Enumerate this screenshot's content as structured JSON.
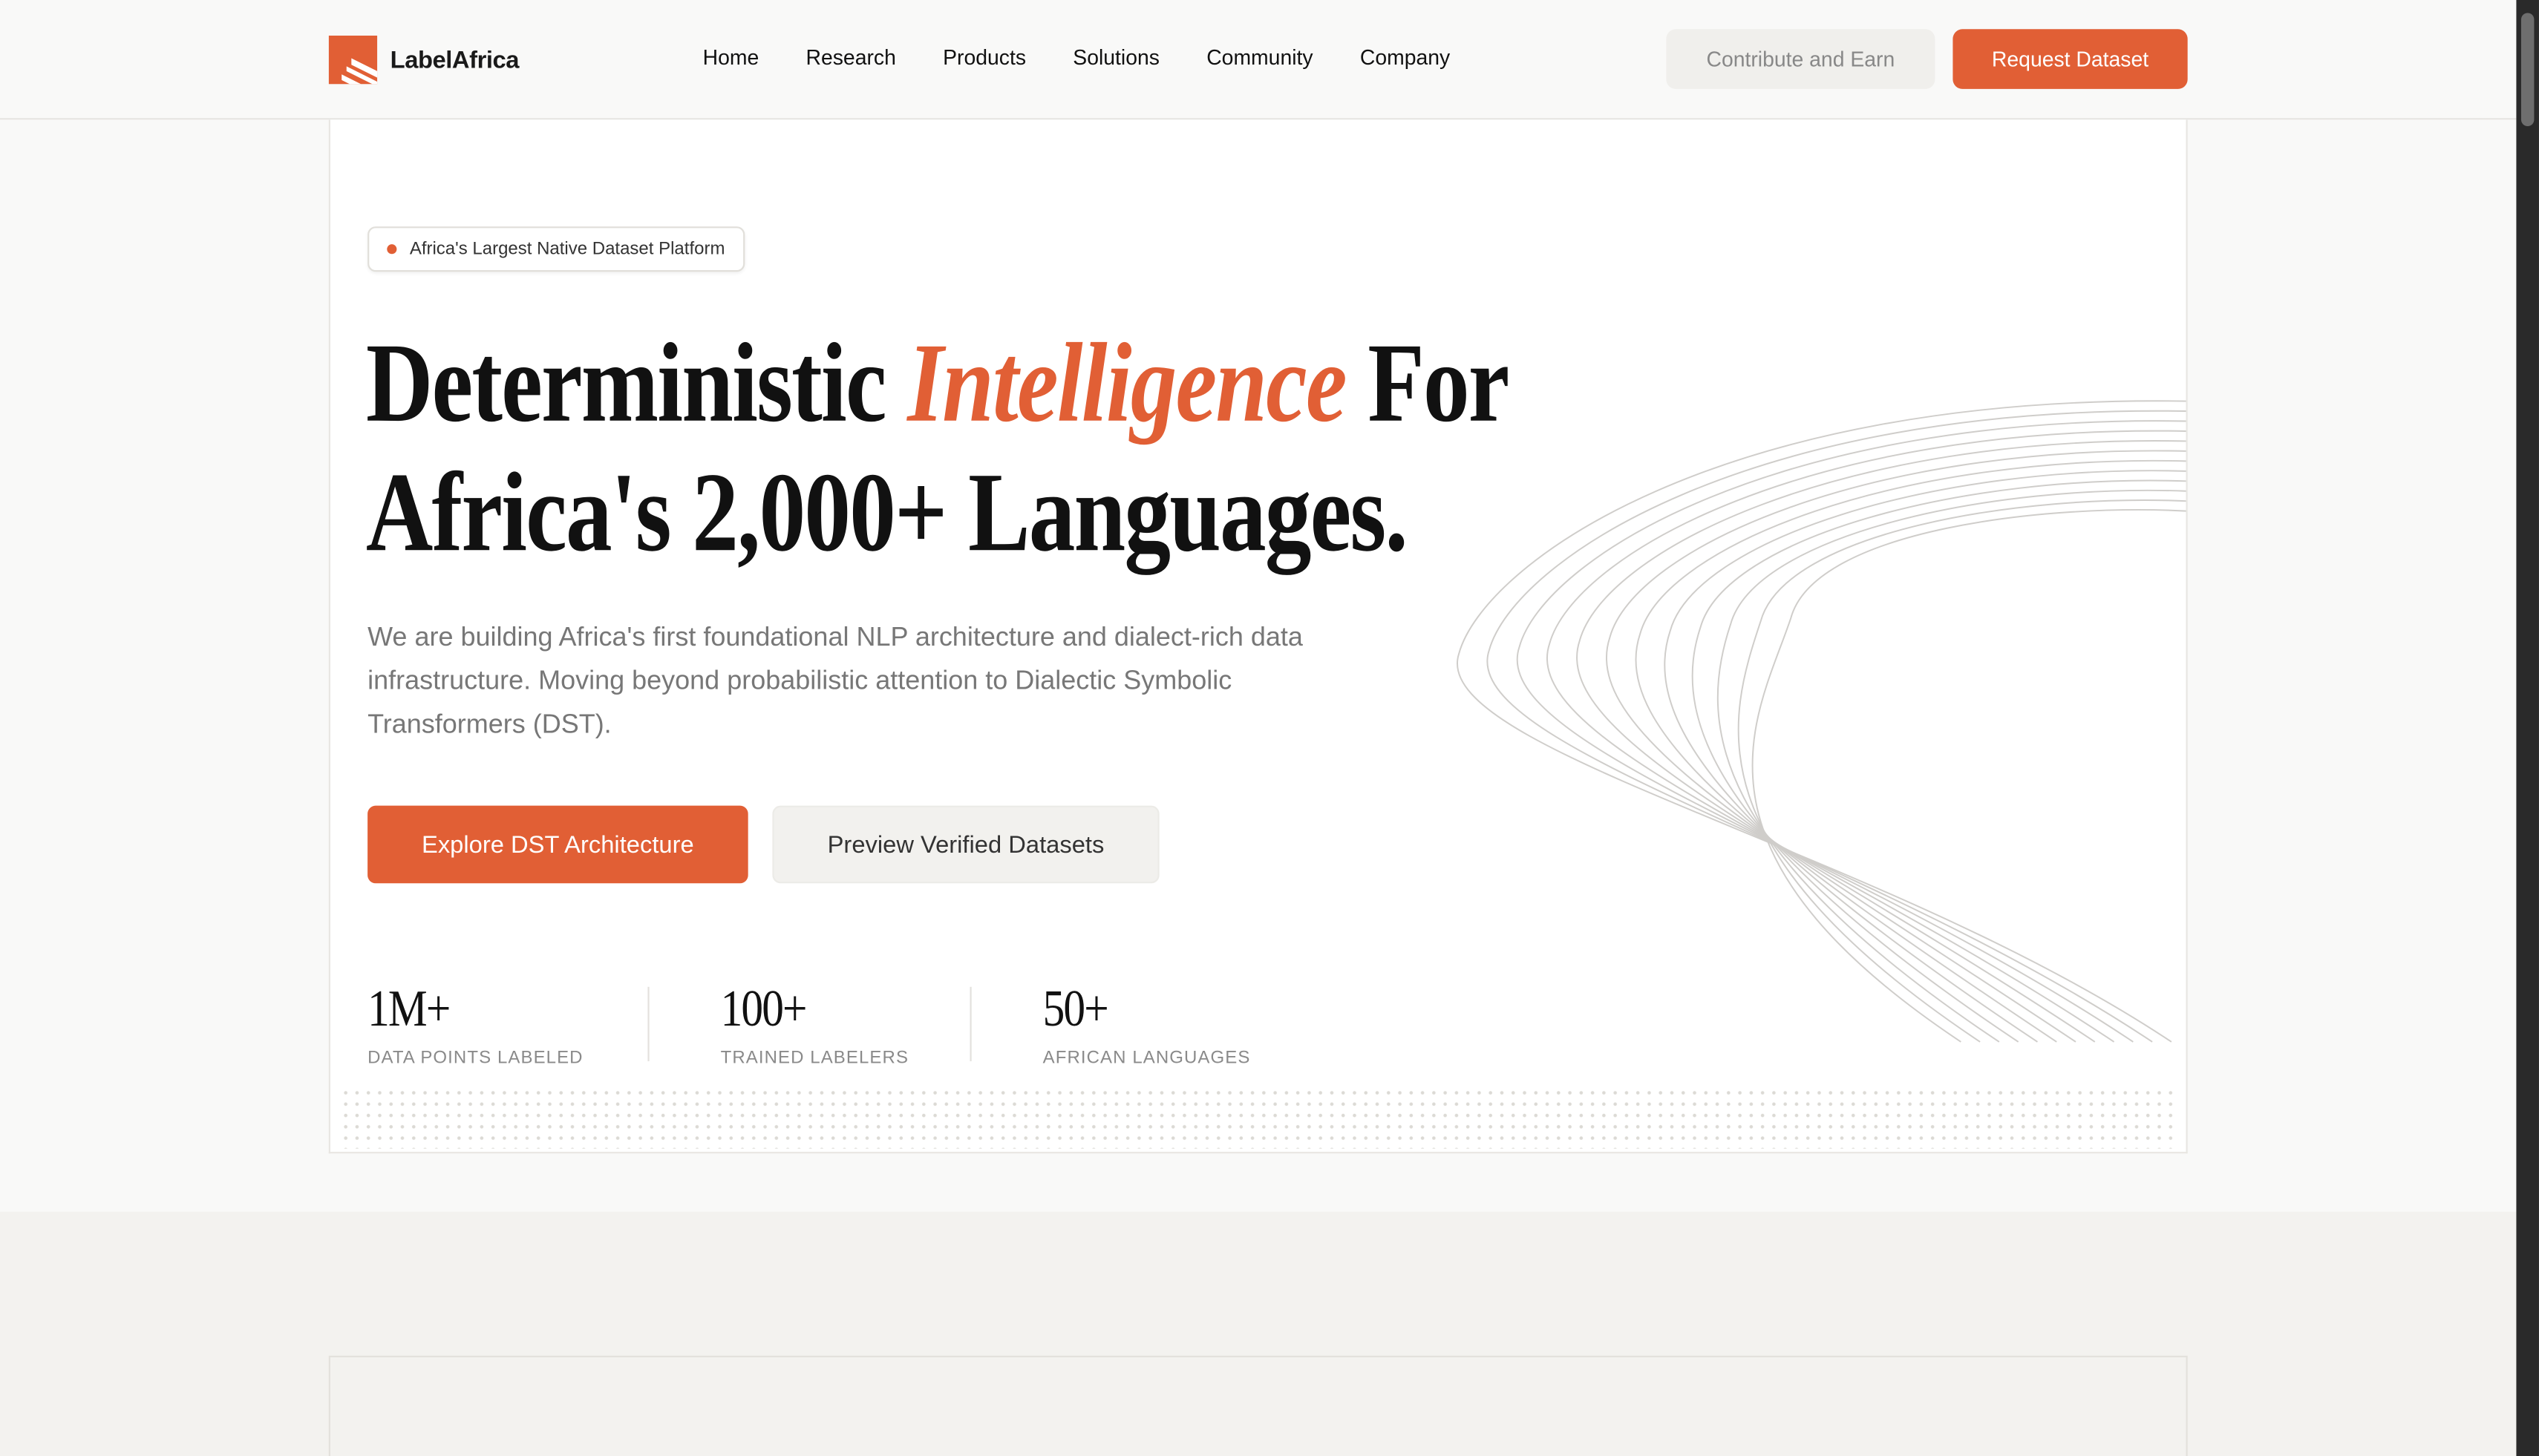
{
  "header": {
    "brand": "LabelAfrica",
    "nav": [
      "Home",
      "Research",
      "Products",
      "Solutions",
      "Community",
      "Company"
    ],
    "contribute_label": "Contribute and Earn",
    "request_label": "Request Dataset"
  },
  "hero": {
    "badge": "Africa's Largest Native Dataset Platform",
    "headline_before": "Deterministic ",
    "headline_accent": "Intelligence",
    "headline_after": " For",
    "headline_line2": "Africa's 2,000+ Languages.",
    "subtext": "We are building Africa's first foundational NLP architecture and dialect-rich data infrastructure. Moving beyond probabilistic attention to Dialectic Symbolic Transformers (DST).",
    "primary_cta": "Explore DST Architecture",
    "secondary_cta": "Preview Verified Datasets",
    "stats": [
      {
        "value": "1M+",
        "label": "DATA POINTS LABELED"
      },
      {
        "value": "100+",
        "label": "TRAINED LABELERS"
      },
      {
        "value": "50+",
        "label": "AFRICAN LANGUAGES"
      }
    ]
  },
  "colors": {
    "accent": "#e15f35",
    "page_bg": "#f3f2ef",
    "card_bg": "#ffffff",
    "muted_text": "#777777"
  },
  "icons": {
    "logo": "labelafrica-logo-icon",
    "badge_dot": "status-dot-icon"
  }
}
